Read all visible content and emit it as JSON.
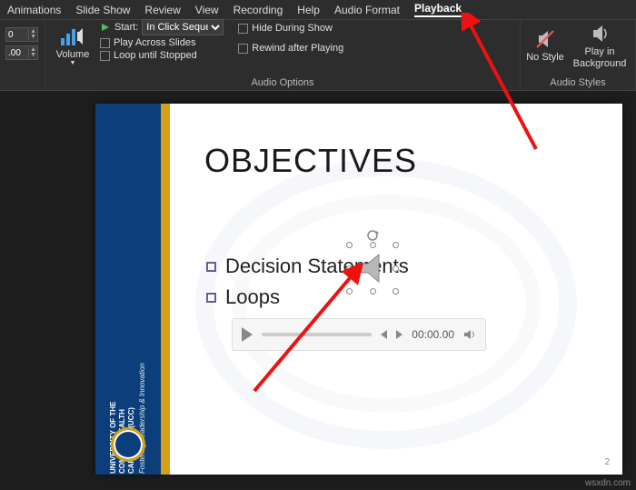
{
  "tabs": [
    "Animations",
    "Slide Show",
    "Review",
    "View",
    "Recording",
    "Help",
    "Audio Format",
    "Playback"
  ],
  "active_tab": "Playback",
  "ribbon": {
    "fade": {
      "val1": "0",
      "val2": ".00"
    },
    "volume_label": "Volume",
    "start_label": "Start:",
    "start_value": "In Click Sequence",
    "play_across": "Play Across Slides",
    "loop_until": "Loop until Stopped",
    "hide_during": "Hide During Show",
    "rewind_after": "Rewind after Playing",
    "group_audio_options": "Audio Options",
    "no_style": "No Style",
    "play_bg": "Play in Background",
    "group_audio_styles": "Audio Styles"
  },
  "slide": {
    "title": "OBJECTIVES",
    "bullets": [
      "Decision Statements",
      "Loops"
    ],
    "sidebar_line1": "UNIVERSITY OF THE",
    "sidebar_line2": "COMMONWEALTH",
    "sidebar_line3": "CARIBBEAN (UCC)",
    "sidebar_tagline": "Fostering Leadership & Innovation",
    "page_number": "2",
    "player_time": "00:00.00"
  },
  "credit": "wsxdn.com"
}
